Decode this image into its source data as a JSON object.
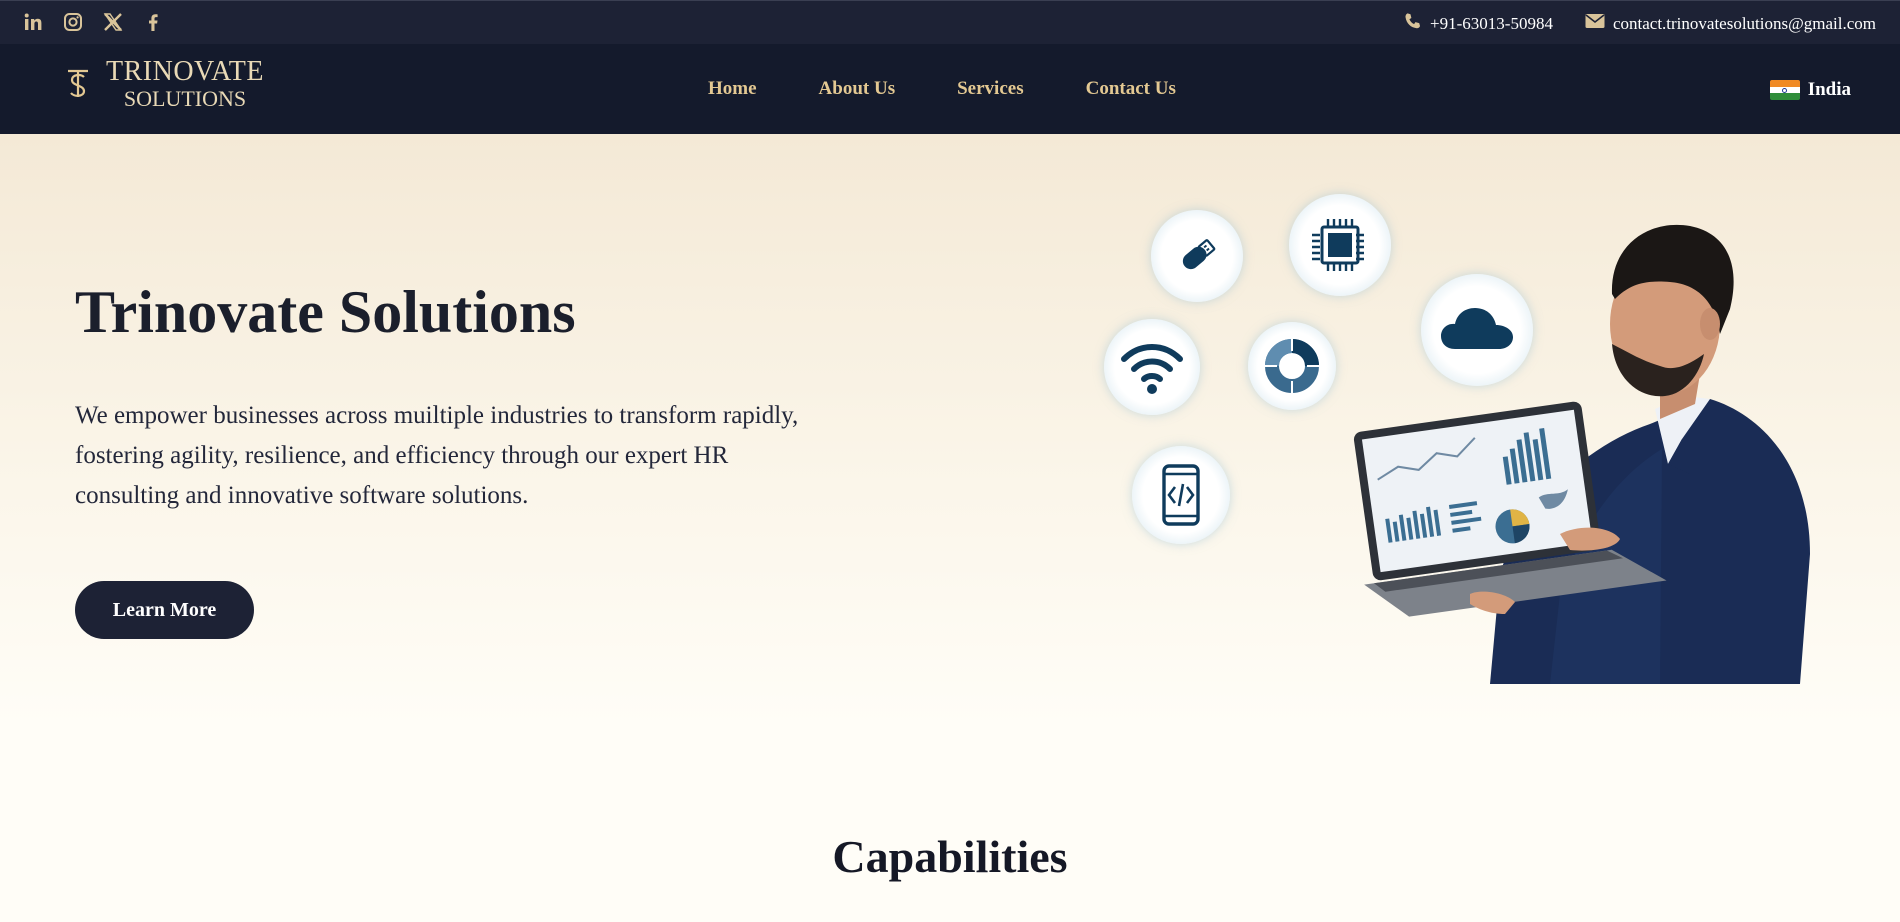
{
  "topbar": {
    "social": [
      "linkedin-icon",
      "instagram-icon",
      "x-icon",
      "facebook-icon"
    ],
    "phone": "+91-63013-50984",
    "email": "contact.trinovatesolutions@gmail.com"
  },
  "nav": {
    "logo_line1": "TRINOVATE",
    "logo_line2": "SOLUTIONS",
    "items": [
      "Home",
      "About Us",
      "Services",
      "Contact Us"
    ],
    "region": "India"
  },
  "hero": {
    "title": "Trinovate Solutions",
    "description": "We empower businesses across muiltiple industries to transform rapidly, fostering agility, resilience, and efficiency through our expert HR consulting and innovative software solutions.",
    "button": "Learn More",
    "bubble_icons": [
      "usb-drive-icon",
      "chip-icon",
      "cloud-icon",
      "wifi-icon",
      "donut-chart-icon",
      "mobile-code-icon"
    ]
  },
  "section": {
    "title": "Capabilities"
  },
  "colors": {
    "navy": "#1d2235",
    "gold": "#e3c892",
    "hero_bg": "#f4e9d6"
  }
}
